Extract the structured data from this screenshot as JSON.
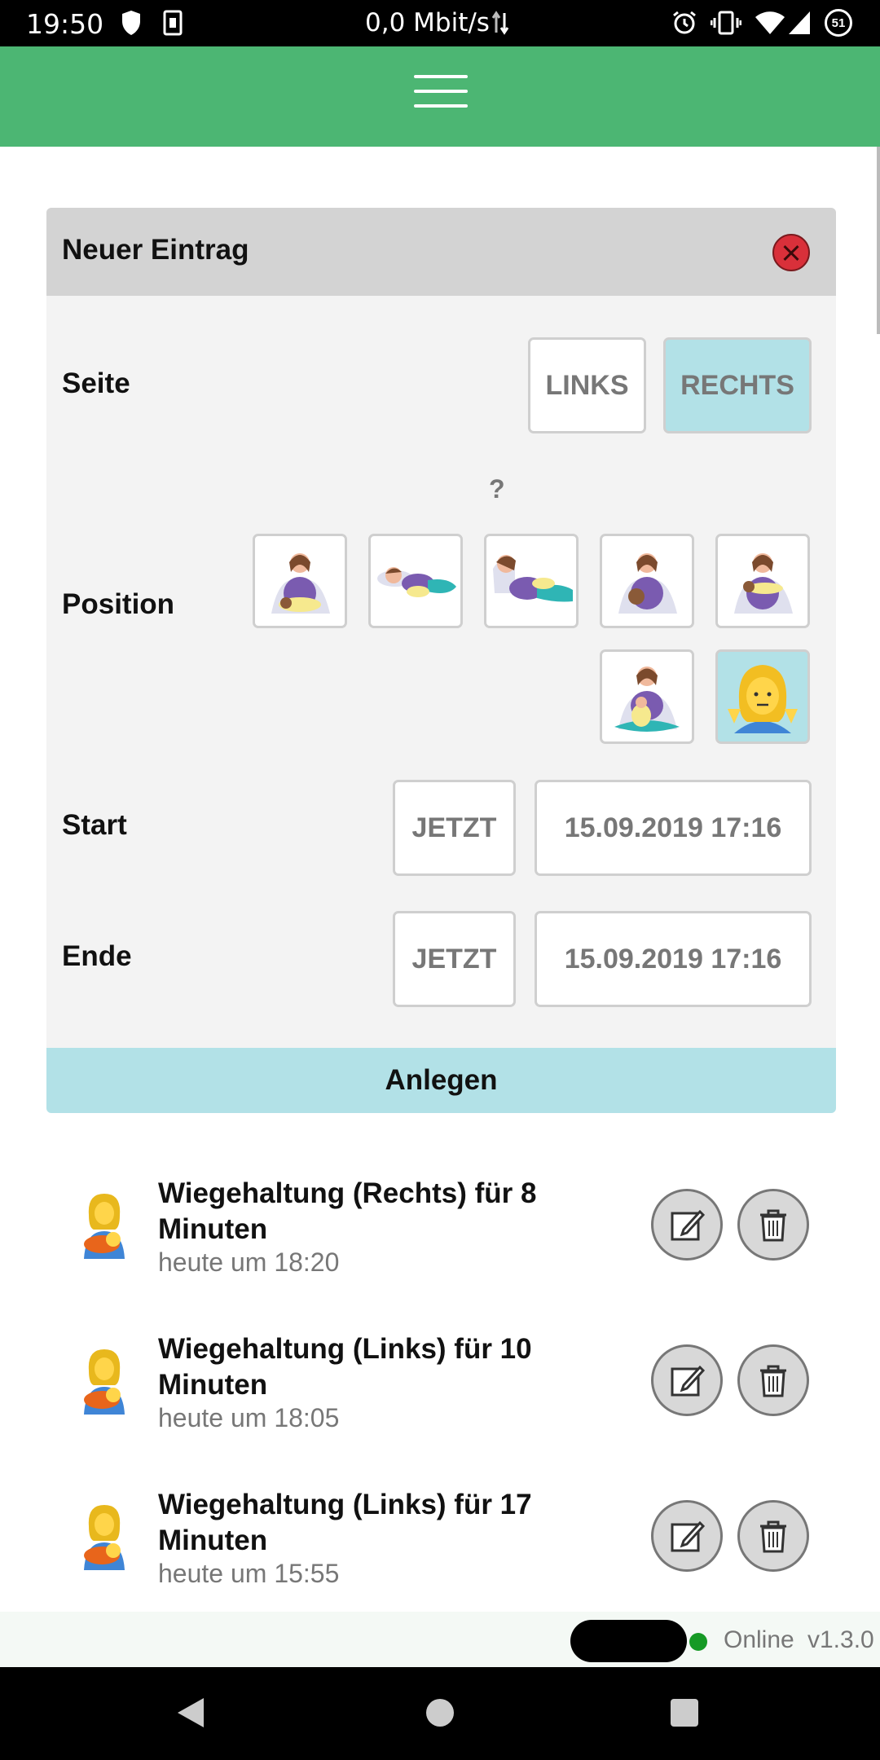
{
  "status_bar": {
    "time": "19:50",
    "network_speed": "0,0 Mbit/s",
    "battery_level": "51"
  },
  "header": {
    "menu_icon": "hamburger-menu-icon"
  },
  "form": {
    "title": "Neuer Eintrag",
    "side_label": "Seite",
    "side_options": [
      "LINKS",
      "RECHTS"
    ],
    "side_selected": "RECHTS",
    "position_help": "?",
    "position_label": "Position",
    "position_selected_index": 6,
    "start_label": "Start",
    "start_now": "JETZT",
    "start_value": "15.09.2019 17:16",
    "end_label": "Ende",
    "end_now": "JETZT",
    "end_value": "15.09.2019 17:16",
    "submit_label": "Anlegen"
  },
  "entries": [
    {
      "title": "Wiegehaltung (Rechts) für 8 Minuten",
      "time": "heute um 18:20"
    },
    {
      "title": "Wiegehaltung (Links) für 10 Minuten",
      "time": "heute um 18:05"
    },
    {
      "title": "Wiegehaltung (Links) für 17 Minuten",
      "time": "heute um 15:55"
    }
  ],
  "footer": {
    "status": "Online",
    "version": "v1.3.0"
  },
  "colors": {
    "header_green": "#4cb673",
    "selected_blue": "#b2e1e7",
    "close_red": "#d9303a",
    "online_green": "#169a25"
  }
}
